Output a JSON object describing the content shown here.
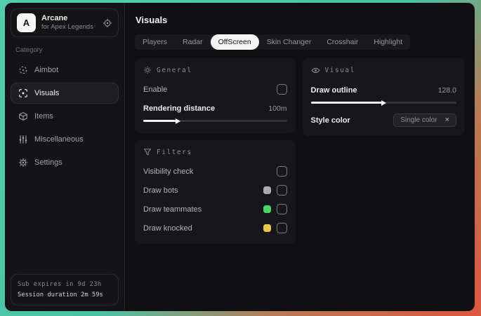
{
  "app": {
    "title": "Arcane",
    "subtitle": "for Apex Legends",
    "logo_letter": "A"
  },
  "sidebar": {
    "category_label": "Category",
    "items": [
      {
        "label": "Aimbot"
      },
      {
        "label": "Visuals"
      },
      {
        "label": "Items"
      },
      {
        "label": "Miscellaneous"
      },
      {
        "label": "Settings"
      }
    ],
    "footer": {
      "sub_expires": "Sub expires in 9d 23h",
      "session_duration": "Session duration 2m 59s"
    }
  },
  "main": {
    "title": "Visuals",
    "tabs": [
      {
        "label": "Players"
      },
      {
        "label": "Radar"
      },
      {
        "label": "OffScreen"
      },
      {
        "label": "Skin Changer"
      },
      {
        "label": "Crosshair"
      },
      {
        "label": "Highlight"
      }
    ],
    "panels": {
      "general": {
        "title": "General",
        "enable_label": "Enable",
        "rendering_label": "Rendering distance",
        "rendering_value": "100m",
        "rendering_percent": 23
      },
      "visual": {
        "title": "Visual",
        "outline_label": "Draw outline",
        "outline_value": "128.0",
        "outline_percent": 49,
        "style_label": "Style color",
        "style_value": "Single color",
        "close_glyph": "×"
      },
      "filters": {
        "title": "Filters",
        "rows": [
          {
            "label": "Visibility check",
            "swatch": null
          },
          {
            "label": "Draw bots",
            "swatch": "#ababad"
          },
          {
            "label": "Draw teammates",
            "swatch": "#4cd36a"
          },
          {
            "label": "Draw knocked",
            "swatch": "#e3c74e"
          }
        ]
      }
    }
  },
  "colors": {
    "desktop_teal": "#4ac2a4",
    "desktop_red": "#dd5640",
    "window_bg": "#101013",
    "panel_bg": "#17171b",
    "active_tab_bg": "#f4f4f4",
    "slider_fill": "#f2f2f2"
  }
}
